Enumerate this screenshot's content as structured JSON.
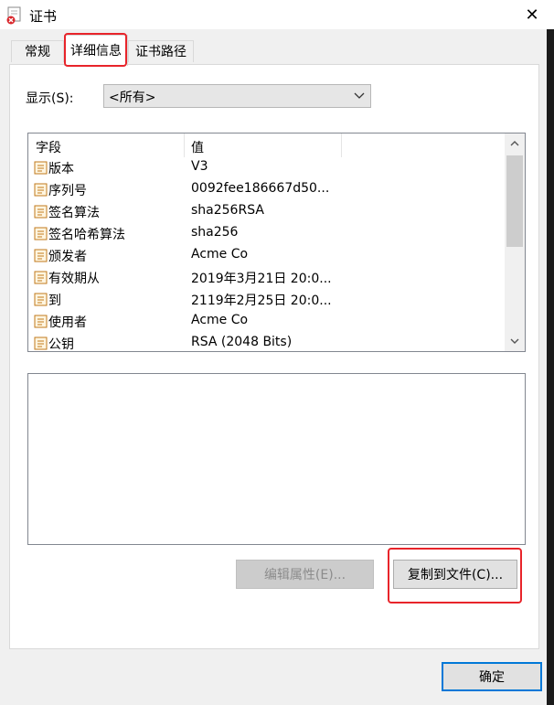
{
  "window": {
    "title": "证书",
    "close_glyph": "✕"
  },
  "tabs": [
    {
      "label": "常规",
      "active": false
    },
    {
      "label": "详细信息",
      "active": true
    },
    {
      "label": "证书路径",
      "active": false
    }
  ],
  "show": {
    "label": "显示(S):",
    "selected": "<所有>"
  },
  "list": {
    "columns": [
      "字段",
      "值"
    ],
    "rows": [
      {
        "field": "版本",
        "value": "V3"
      },
      {
        "field": "序列号",
        "value": "0092fee186667d50..."
      },
      {
        "field": "签名算法",
        "value": "sha256RSA"
      },
      {
        "field": "签名哈希算法",
        "value": "sha256"
      },
      {
        "field": "颁发者",
        "value": "Acme Co"
      },
      {
        "field": "有效期从",
        "value": "2019年3月21日 20:0..."
      },
      {
        "field": "到",
        "value": "2119年2月25日 20:0..."
      },
      {
        "field": "使用者",
        "value": "Acme Co"
      },
      {
        "field": "公钥",
        "value": "RSA (2048 Bits)"
      }
    ]
  },
  "buttons": {
    "edit_properties": "编辑属性(E)...",
    "copy_to_file": "复制到文件(C)...",
    "ok": "确定"
  },
  "colors": {
    "highlight": "#e8242a",
    "accent": "#0078d7",
    "row_icon": "#c07a1c"
  }
}
